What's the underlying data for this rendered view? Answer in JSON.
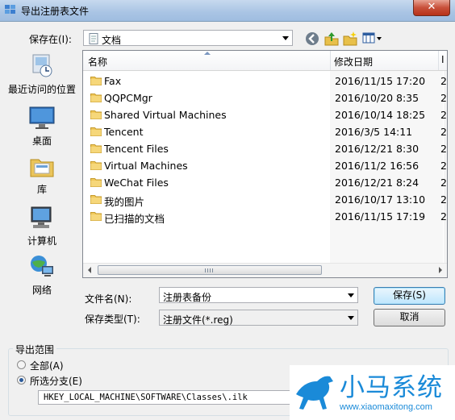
{
  "window": {
    "title": "导出注册表文件",
    "close": "✕"
  },
  "location": {
    "label": "保存在(I):",
    "value": "文档"
  },
  "toolbar": [
    "back-icon",
    "up-folder-icon",
    "new-folder-icon",
    "view-menu-icon"
  ],
  "places": [
    {
      "name": "最近访问的位置",
      "icon": "recent-places-icon"
    },
    {
      "name": "桌面",
      "icon": "desktop-icon"
    },
    {
      "name": "库",
      "icon": "libraries-icon"
    },
    {
      "name": "计算机",
      "icon": "computer-icon"
    },
    {
      "name": "网络",
      "icon": "network-icon"
    }
  ],
  "columns": {
    "name": "名称",
    "date": "修改日期",
    "extra": "Ⅰ"
  },
  "files": [
    {
      "name": "Fax",
      "date": "2016/11/15 17:20",
      "x": "2"
    },
    {
      "name": "QQPCMgr",
      "date": "2016/10/20 8:35",
      "x": "2"
    },
    {
      "name": "Shared Virtual Machines",
      "date": "2016/10/14 18:25",
      "x": "2"
    },
    {
      "name": "Tencent",
      "date": "2016/3/5 14:11",
      "x": "2"
    },
    {
      "name": "Tencent Files",
      "date": "2016/12/21 8:30",
      "x": "2"
    },
    {
      "name": "Virtual Machines",
      "date": "2016/11/2 16:56",
      "x": "2"
    },
    {
      "name": "WeChat Files",
      "date": "2016/12/21 8:24",
      "x": "2"
    },
    {
      "name": "我的图片",
      "date": "2016/10/17 13:10",
      "x": "2"
    },
    {
      "name": "已扫描的文档",
      "date": "2016/11/15 17:19",
      "x": "2"
    }
  ],
  "filename": {
    "label": "文件名(N):",
    "value": "注册表备份"
  },
  "filetype": {
    "label": "保存类型(T):",
    "value": "注册文件(*.reg)"
  },
  "buttons": {
    "save": "保存(S)",
    "cancel": "取消"
  },
  "export": {
    "title": "导出范围",
    "all": "全部(A)",
    "branch": "所选分支(E)",
    "selected": "branch",
    "path": "HKEY_LOCAL_MACHINE\\SOFTWARE\\Classes\\.ilk"
  },
  "watermark": {
    "big": "小马系统",
    "small": "www.xiaomaxitong.com"
  }
}
